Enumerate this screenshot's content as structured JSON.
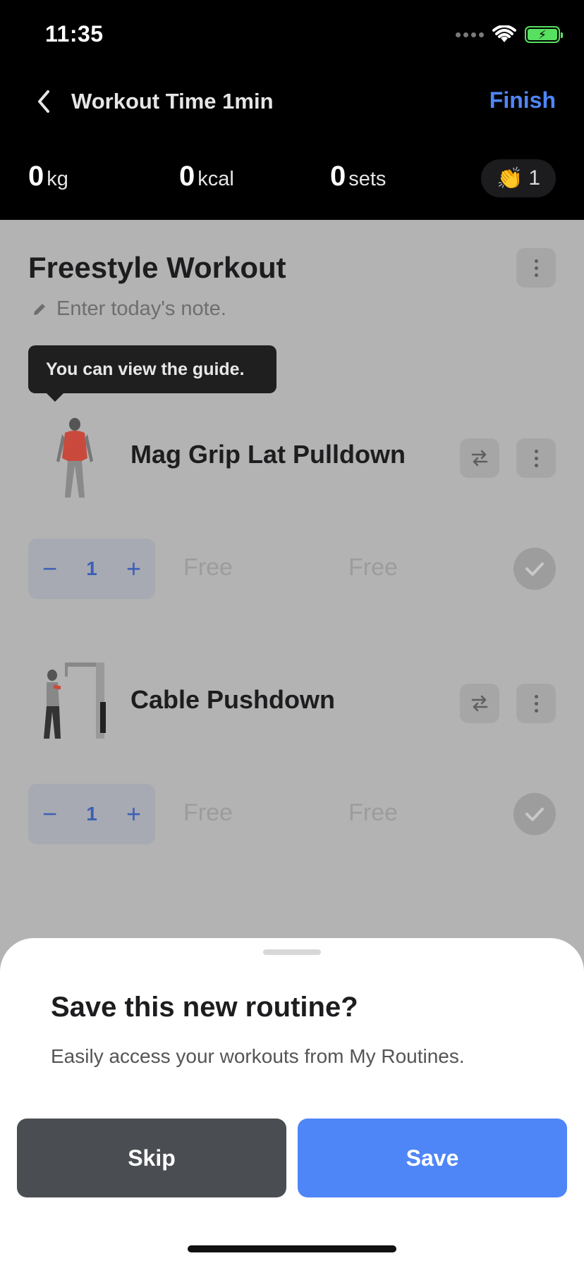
{
  "status_bar": {
    "time": "11:35"
  },
  "nav": {
    "title": "Workout Time 1min",
    "finish_label": "Finish"
  },
  "stats": {
    "weight": {
      "value": "0",
      "unit": "kg"
    },
    "calories": {
      "value": "0",
      "unit": "kcal"
    },
    "sets": {
      "value": "0",
      "unit": "sets"
    },
    "claps": {
      "count": "1"
    }
  },
  "workout": {
    "title": "Freestyle Workout",
    "note_placeholder": "Enter today's note.",
    "tooltip": "You can view the guide."
  },
  "exercises": [
    {
      "name": "Mag Grip Lat Pulldown",
      "set_count": "1",
      "weight": "Free",
      "reps": "Free"
    },
    {
      "name": "Cable Pushdown",
      "set_count": "1",
      "weight": "Free",
      "reps": "Free"
    }
  ],
  "sheet": {
    "title": "Save this new routine?",
    "description": "Easily access your workouts from My Routines.",
    "skip_label": "Skip",
    "save_label": "Save"
  },
  "colors": {
    "accent": "#4f86f7",
    "dark_button": "#4a4d52",
    "overlay_bg": "#b3b3b3"
  }
}
